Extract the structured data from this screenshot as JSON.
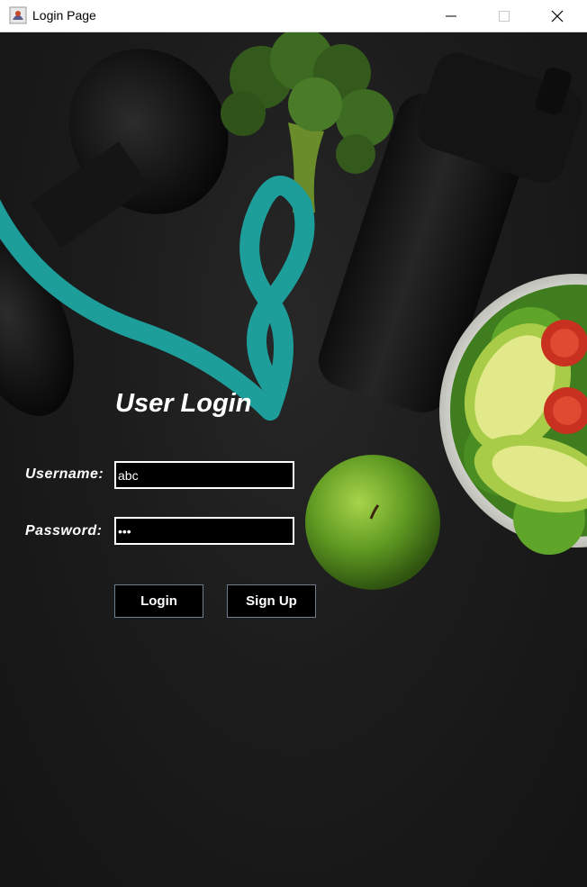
{
  "window": {
    "title": "Login Page",
    "controls": [
      "minimize-icon",
      "maximize-icon",
      "close-icon"
    ]
  },
  "login": {
    "heading": "User Login",
    "username_label": "Username:",
    "username_value": "abc",
    "password_label": "Password:",
    "password_value": "abc",
    "login_button": "Login",
    "signup_button": "Sign Up"
  },
  "background": {
    "description_icons": [
      "dumbbell-image",
      "broccoli-image",
      "measuring-tape-image",
      "shaker-bottle-image",
      "salad-bowl-image",
      "apple-image"
    ],
    "colors": {
      "background": "#1c1c1c",
      "tape": "#1e9e9a",
      "apple": "#6aa42a",
      "broccoli": "#3e6b22",
      "avocado": "#9cc93f",
      "tomato": "#c83020"
    }
  }
}
